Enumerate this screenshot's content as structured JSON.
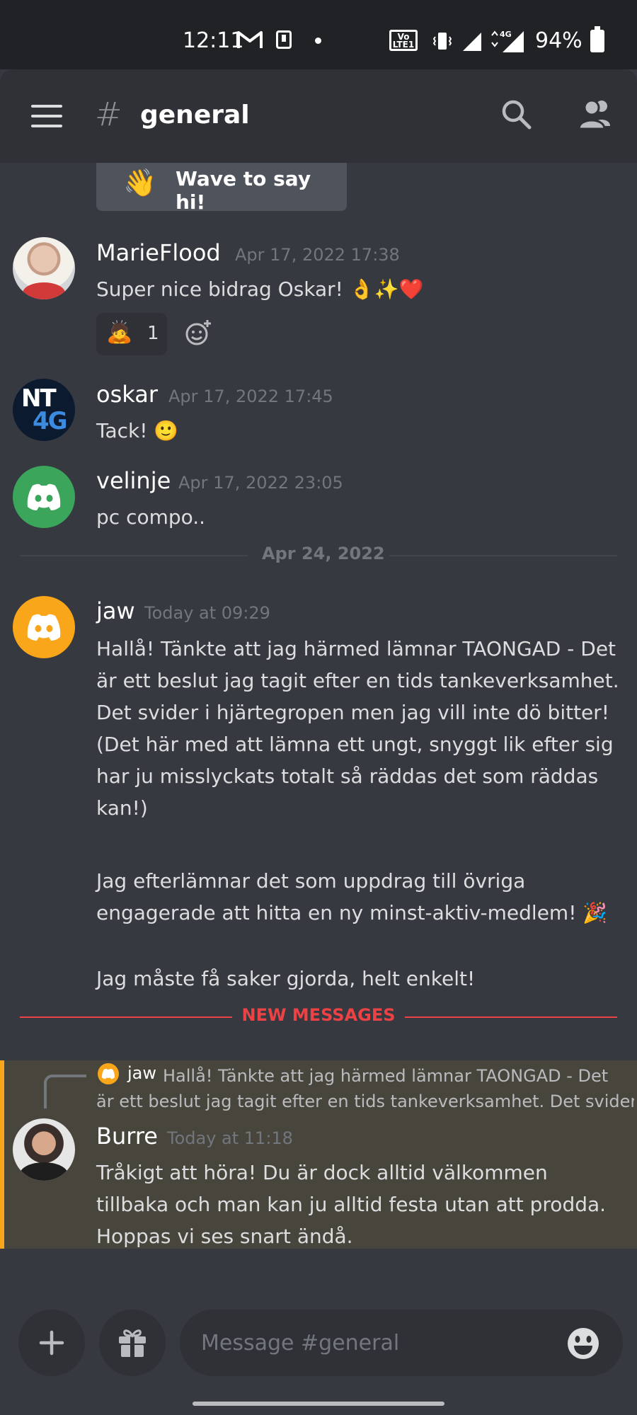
{
  "status_bar": {
    "time": "12:11",
    "battery": "94%",
    "volte_label": "Vo LTE1",
    "network_label": "4G"
  },
  "header": {
    "channel_name": "general"
  },
  "wave_button": {
    "label": "Wave to say hi!",
    "emoji": "👋"
  },
  "messages": [
    {
      "author": "MarieFlood",
      "timestamp": "Apr 17, 2022 17:38",
      "text": "Super nice bidrag Oskar! 👌✨❤️",
      "reaction": {
        "emoji": "🙇",
        "count": "1"
      }
    },
    {
      "author": "oskar",
      "timestamp": "Apr 17, 2022 17:45",
      "text": "Tack! 🙂",
      "avatar_text": [
        "NT",
        "4G"
      ]
    },
    {
      "author": "velinje",
      "timestamp": "Apr 17, 2022 23:05",
      "text": "pc compo.."
    },
    {
      "author": "jaw",
      "timestamp": "Today at 09:29",
      "paragraphs": [
        "Hallå! Tänkte att jag härmed lämnar TAONGAD - Det är ett beslut jag tagit efter en tids tankeverksamhet. Det svider i hjärtegropen men jag vill inte dö bitter! (Det här med att lämna ett ungt, snyggt lik efter sig har ju misslyckats totalt så räddas det som räddas kan!)",
        "Jag efterlämnar det som uppdrag till övriga engagerade att hitta en ny minst-aktiv-medlem! 🎉",
        "Jag måste få saker gjorda, helt enkelt!"
      ]
    },
    {
      "author": "Burre",
      "timestamp": "Today at 11:18",
      "reply": {
        "author": "jaw",
        "text_line1": "Hallå! Tänkte att jag härmed lämnar TAONGAD - Det",
        "text_line2": "är ett beslut jag tagit efter en tids tankeverksamhet. Det svider i"
      },
      "text": "Tråkigt att höra! Du är dock alltid välkommen tillbaka och man kan ju alltid festa utan att prodda. Hoppas vi ses snart ändå."
    }
  ],
  "dividers": {
    "date": "Apr 24, 2022",
    "new_messages": "NEW MESSAGES"
  },
  "composer": {
    "placeholder": "Message #general"
  },
  "colors": {
    "background": "#36393f",
    "header": "#2f3136",
    "new_messages": "#ed4245",
    "highlight_border": "#faa61a",
    "highlight_bg": "#48453c",
    "discord_green": "#3ba55c",
    "discord_orange": "#faa61a"
  },
  "icons": [
    "gmail-icon",
    "download-icon",
    "vibrate-icon",
    "signal-icon",
    "battery-icon",
    "menu-icon",
    "hash-icon",
    "search-icon",
    "members-icon",
    "add-reaction-icon",
    "plus-icon",
    "gift-icon",
    "emoji-icon",
    "discord-logo-icon"
  ]
}
